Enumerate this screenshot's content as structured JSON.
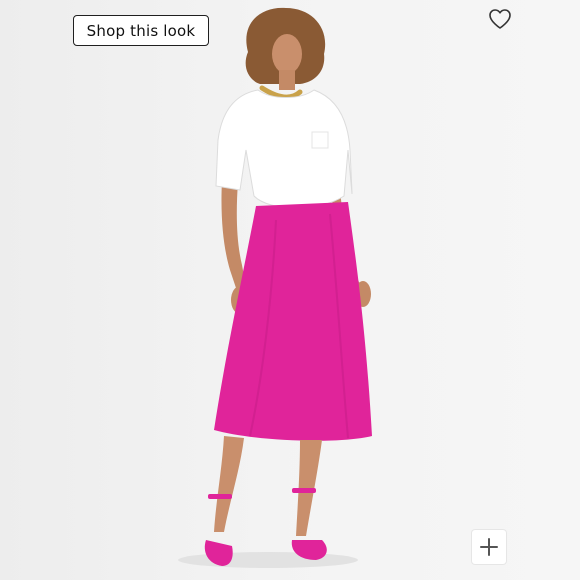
{
  "listing": {
    "shop_button_label": "Shop this look",
    "favorite_icon": "heart-outline-icon",
    "zoom_icon": "plus-icon"
  },
  "colors": {
    "skirt": "#e0249a",
    "shirt": "#ffffff",
    "background": "#f2f2f2",
    "button_border": "#1f1f1f"
  }
}
